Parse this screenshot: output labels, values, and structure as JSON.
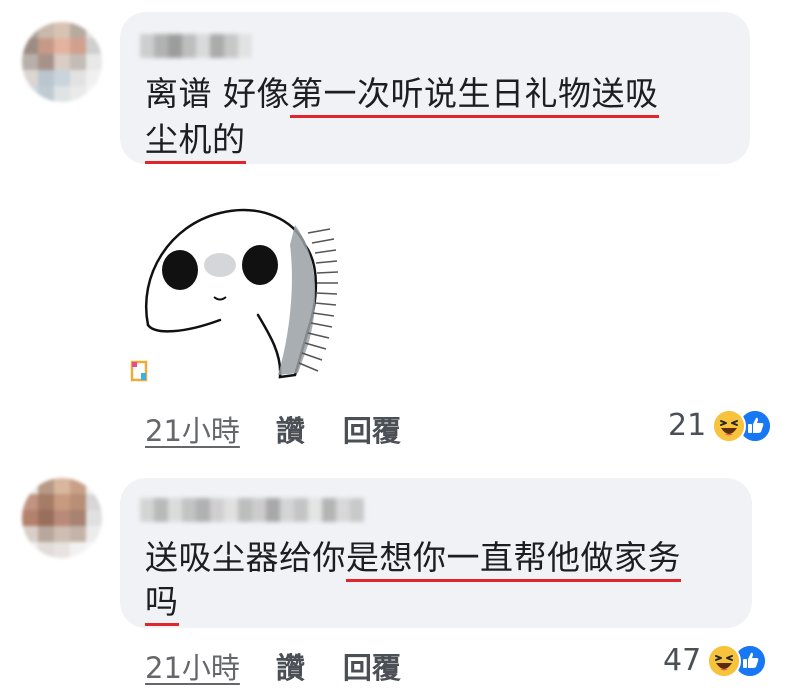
{
  "comments": [
    {
      "lines": [
        [
          {
            "t": "离谱  好像"
          },
          {
            "t": "第一次听说生日礼物送吸",
            "u": true
          }
        ],
        [
          {
            "t": "尘机的",
            "u": true
          }
        ]
      ],
      "time": "21小時",
      "like_label": "讚",
      "reply_label": "回覆",
      "reaction_count": "21",
      "has_sticker": true
    },
    {
      "lines": [
        [
          {
            "t": "送吸尘器给你"
          },
          {
            "t": "是想你一直帮他做家务",
            "u": true
          }
        ],
        [
          {
            "t": "吗",
            "u": true
          }
        ]
      ],
      "time": "21小時",
      "like_label": "讚",
      "reply_label": "回覆",
      "reaction_count": "47",
      "has_sticker": false
    }
  ],
  "reaction_icons": [
    "haha-emoji-icon",
    "like-thumb-icon"
  ],
  "colors": {
    "bubble_bg": "#f0f2f5",
    "underline": "#e0252b",
    "like_blue": "#1877f2",
    "haha_yellow": "#f7c33c",
    "meta_gray": "#65676b"
  }
}
